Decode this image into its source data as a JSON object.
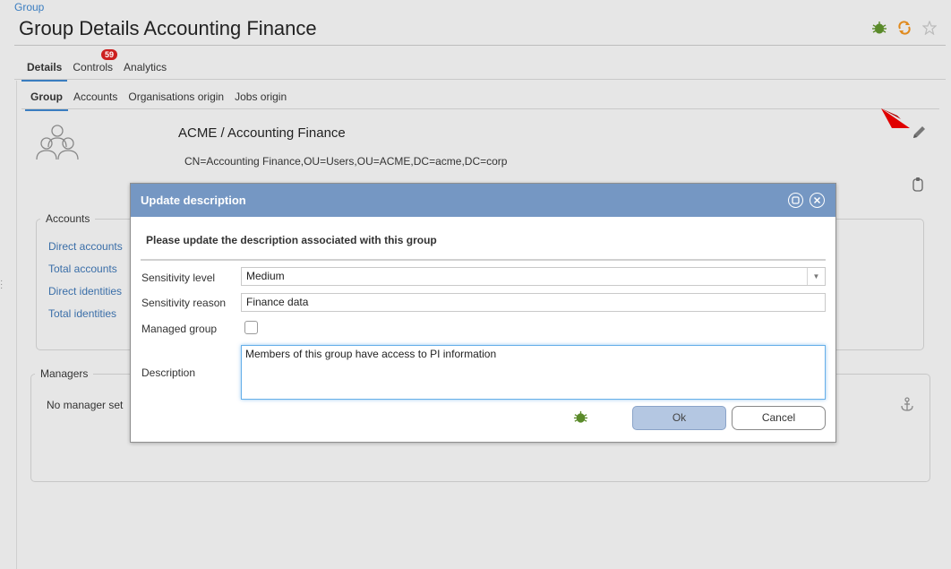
{
  "breadcrumb": "Group",
  "page_title": "Group Details Accounting Finance",
  "header_icons": [
    "bug-icon",
    "sync-icon",
    "star-icon"
  ],
  "main_tabs": [
    {
      "label": "Details",
      "active": true
    },
    {
      "label": "Controls",
      "badge": "59"
    },
    {
      "label": "Analytics"
    }
  ],
  "sub_tabs": [
    {
      "label": "Group",
      "active": true
    },
    {
      "label": "Accounts"
    },
    {
      "label": "Organisations origin"
    },
    {
      "label": "Jobs origin"
    }
  ],
  "group": {
    "name": "ACME / Accounting Finance",
    "dn": "CN=Accounting Finance,OU=Users,OU=ACME,DC=acme,DC=corp"
  },
  "accounts": {
    "legend": "Accounts",
    "items": [
      "Direct accounts",
      "Total accounts",
      "Direct identities",
      "Total identities"
    ]
  },
  "managers": {
    "legend": "Managers",
    "empty_text": "No manager set"
  },
  "dialog": {
    "title": "Update description",
    "prompt": "Please update the description associated with this group",
    "sensitivity_level_label": "Sensitivity level",
    "sensitivity_level_value": "Medium",
    "sensitivity_reason_label": "Sensitivity reason",
    "sensitivity_reason_value": "Finance data",
    "managed_group_label": "Managed group",
    "managed_group_checked": false,
    "description_label": "Description",
    "description_value": "Members of this group have access to PI information",
    "ok_label": "Ok",
    "cancel_label": "Cancel"
  },
  "colors": {
    "accent": "#3a7dc0",
    "dialog_header": "#7597c3",
    "badge": "#cc1f1f",
    "annotation_arrow": "#e00000"
  }
}
